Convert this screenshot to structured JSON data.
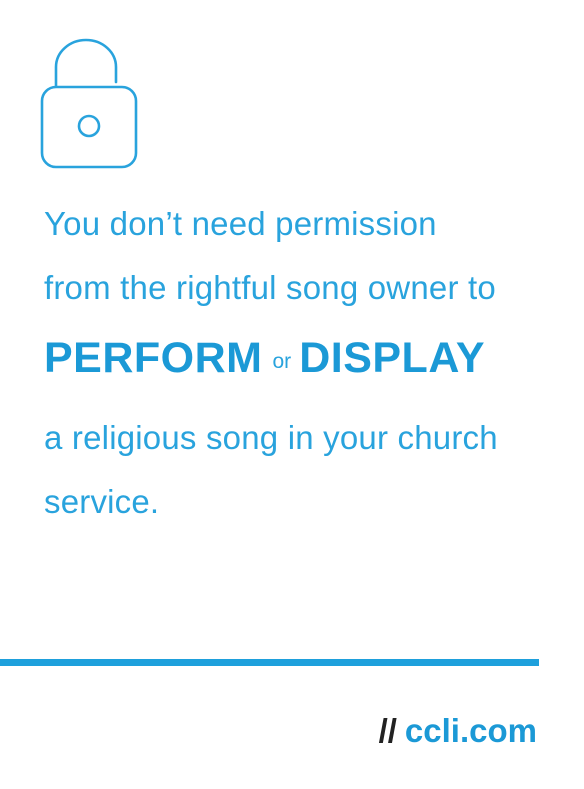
{
  "icon": {
    "name": "unlocked-padlock-icon",
    "color": "#29a3dd"
  },
  "message": {
    "line1": "You don’t need permission",
    "line2": "from the rightful song owner to",
    "emphasis": {
      "word1": "PERFORM",
      "connector": "or",
      "word2": "DISPLAY"
    },
    "line4": "a religious song in your church",
    "line5": "service."
  },
  "footer": {
    "prefix": "//",
    "website": "ccli.com"
  },
  "colors": {
    "accent": "#29a3dd",
    "text_dark": "#222222",
    "background": "#ffffff"
  }
}
